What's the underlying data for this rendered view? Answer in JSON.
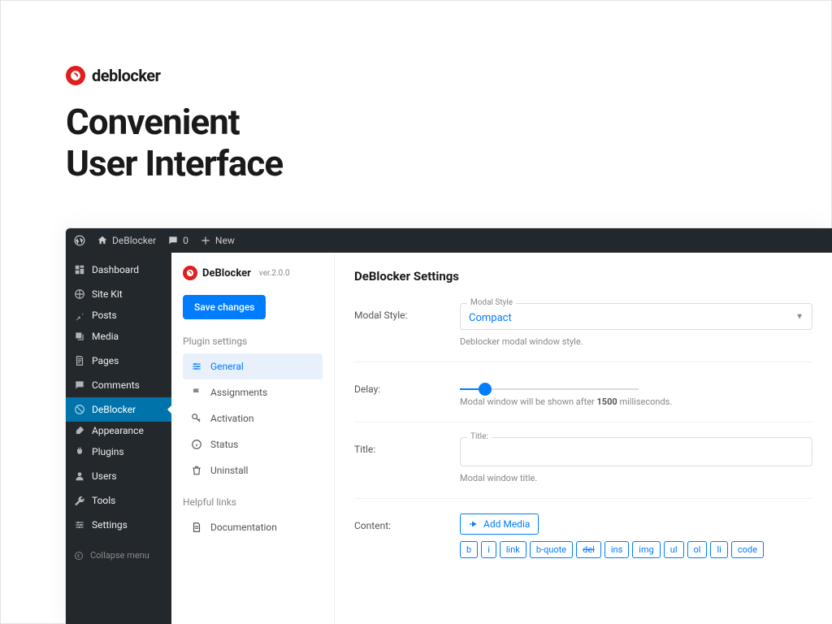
{
  "brand": {
    "name": "deblocker"
  },
  "hero": {
    "line1": "Convenient",
    "line2": "User Interface"
  },
  "topbar": {
    "site_name": "DeBlocker",
    "comments_count": "0",
    "new_label": "New"
  },
  "wp_nav": [
    {
      "label": "Dashboard",
      "icon": "dashboard"
    },
    {
      "label": "Site Kit",
      "icon": "sitekit"
    },
    {
      "label": "Posts",
      "icon": "pin",
      "spacer": true
    },
    {
      "label": "Media",
      "icon": "media"
    },
    {
      "label": "Pages",
      "icon": "pages"
    },
    {
      "label": "Comments",
      "icon": "comments"
    },
    {
      "label": "DeBlocker",
      "icon": "deblocker",
      "active": true
    },
    {
      "label": "Appearance",
      "icon": "brush",
      "spacer": true
    },
    {
      "label": "Plugins",
      "icon": "plugin"
    },
    {
      "label": "Users",
      "icon": "user"
    },
    {
      "label": "Tools",
      "icon": "wrench"
    },
    {
      "label": "Settings",
      "icon": "settings"
    }
  ],
  "collapse_label": "Collapse menu",
  "plugin_panel": {
    "name": "DeBlocker",
    "version": "ver.2.0.0",
    "save_label": "Save changes",
    "section_heading": "Plugin settings",
    "items": [
      {
        "label": "General",
        "icon": "sliders",
        "active": true
      },
      {
        "label": "Assignments",
        "icon": "flag"
      },
      {
        "label": "Activation",
        "icon": "key"
      },
      {
        "label": "Status",
        "icon": "info"
      },
      {
        "label": "Uninstall",
        "icon": "trash"
      }
    ],
    "helpful_heading": "Helpful links",
    "helpful_items": [
      {
        "label": "Documentation",
        "icon": "doc"
      }
    ]
  },
  "settings": {
    "heading": "DeBlocker Settings",
    "modal_style": {
      "label": "Modal Style:",
      "legend": "Modal Style",
      "value": "Compact",
      "help": "Deblocker modal window style."
    },
    "delay": {
      "label": "Delay:",
      "help_prefix": "Modal window will be shown after ",
      "help_value": "1500",
      "help_suffix": " milliseconds."
    },
    "title": {
      "label": "Title:",
      "legend": "Title:",
      "help": "Modal window title."
    },
    "content": {
      "label": "Content:",
      "add_media": "Add Media",
      "toolbar": [
        "b",
        "i",
        "link",
        "b-quote",
        "del",
        "ins",
        "img",
        "ul",
        "ol",
        "li",
        "code"
      ]
    }
  }
}
